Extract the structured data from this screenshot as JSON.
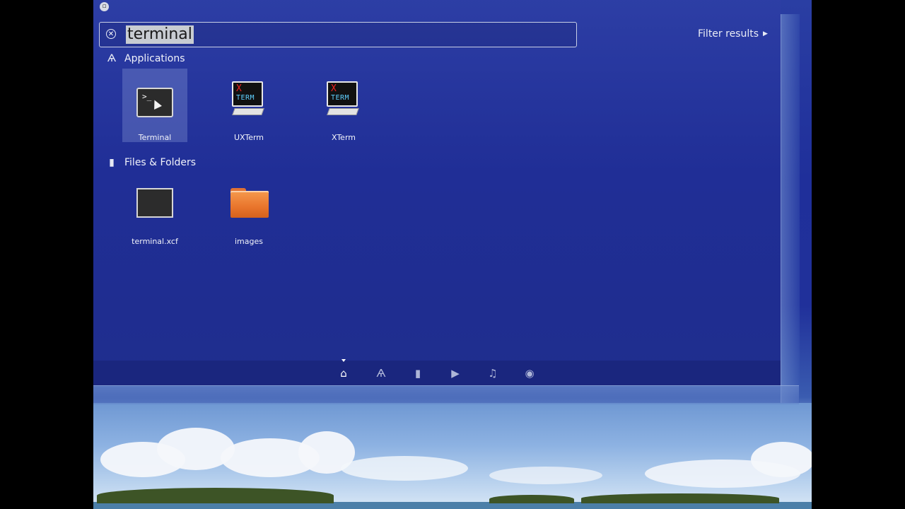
{
  "search": {
    "query": "terminal"
  },
  "filter": {
    "label": "Filter results"
  },
  "categories": {
    "applications": {
      "title": "Applications",
      "items": [
        {
          "label": "Terminal",
          "icon": "terminal-icon"
        },
        {
          "label": "UXTerm",
          "icon": "xterm-icon"
        },
        {
          "label": "XTerm",
          "icon": "xterm-icon"
        }
      ]
    },
    "files": {
      "title": "Files & Folders",
      "items": [
        {
          "label": "terminal.xcf",
          "icon": "image-file-icon"
        },
        {
          "label": "images",
          "icon": "folder-icon"
        }
      ]
    }
  },
  "xterm_icon_text": {
    "x": "X",
    "term": "TERM"
  },
  "lenses": [
    {
      "name": "home-lens",
      "icon": "home-icon",
      "active": true
    },
    {
      "name": "applications-lens",
      "icon": "applications-icon",
      "active": false
    },
    {
      "name": "files-lens",
      "icon": "file-icon",
      "active": false
    },
    {
      "name": "video-lens",
      "icon": "video-icon",
      "active": false
    },
    {
      "name": "music-lens",
      "icon": "music-icon",
      "active": false
    },
    {
      "name": "photo-lens",
      "icon": "camera-icon",
      "active": false
    }
  ],
  "colors": {
    "dash_bg": "#2334a0",
    "highlight": "#c8ccd2",
    "folder": "#ec7a2f"
  }
}
